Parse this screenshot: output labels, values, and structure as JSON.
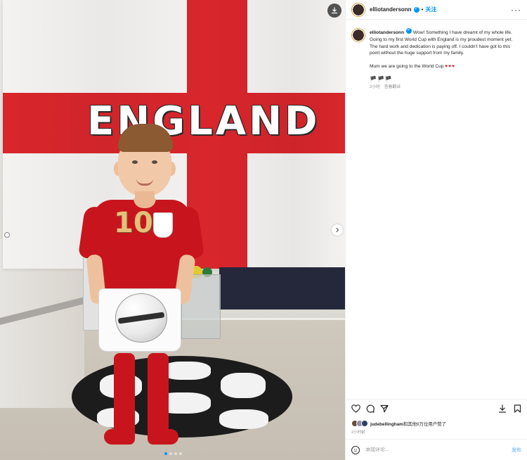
{
  "photo": {
    "flag_text": "ENGLAND",
    "shirt_number": "10",
    "carousel": {
      "total": 4,
      "active": 1
    }
  },
  "post": {
    "username": "elliotandersonn",
    "separator": "•",
    "follow_label": "关注",
    "more_label": "···",
    "caption": {
      "username": "elliotandersonn",
      "text": " Wow! Something I have dreamt of my whole life. Going to my first World Cup with England is my proudest moment yet. The hard work and dedication is paying off. I couldn't have got to this point without the huge support from my family.",
      "line2": "Mum we are going to the World Cup ",
      "hearts": "♥♥♥",
      "flags": "🏴🏴🏴",
      "time": "2小时",
      "translate": "查看翻译"
    },
    "likes": {
      "first_user": "judebellingham",
      "rest": "和其他9万位用户赞了"
    },
    "posted_ago": "2小时前",
    "comment": {
      "placeholder": "添加评论...",
      "post_label": "发布"
    }
  },
  "colors": {
    "accent": "#0095f6",
    "flag_red": "#d8262c",
    "heart_red": "#d0222e"
  }
}
